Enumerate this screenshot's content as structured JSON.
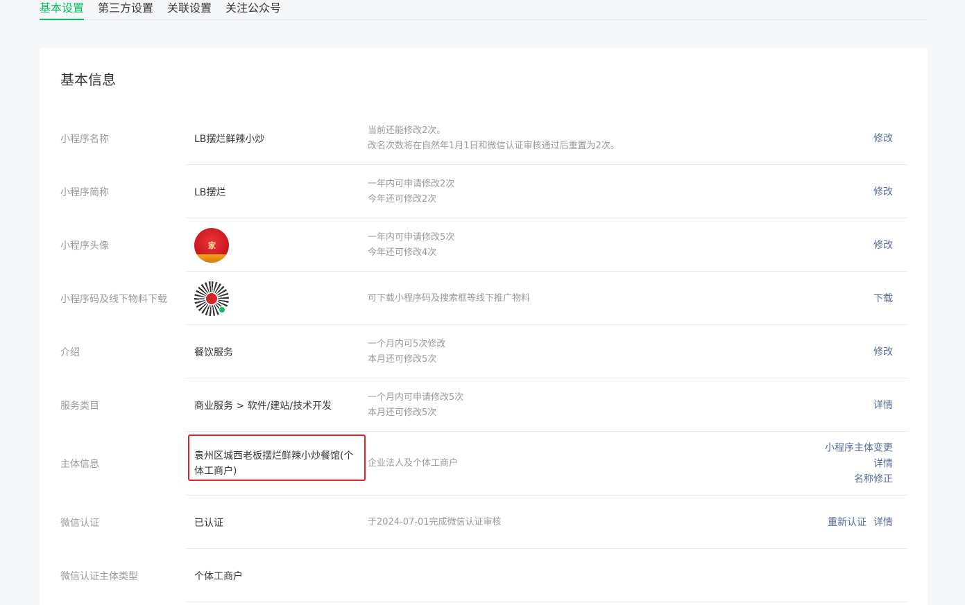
{
  "tabs": [
    "基本设置",
    "第三方设置",
    "关联设置",
    "关注公众号"
  ],
  "card_title": "基本信息",
  "rows": [
    {
      "label": "小程序名称",
      "value": "LB摆烂鲜辣小炒",
      "desc1": "当前还能修改2次。",
      "desc2": "改名次数将在自然年1月1日和微信认证审核通过后重置为2次。",
      "action": "修改"
    },
    {
      "label": "小程序简称",
      "value": "LB摆烂",
      "desc1": "一年内可申请修改2次",
      "desc2": "今年还可修改2次",
      "action": "修改"
    },
    {
      "label": "小程序头像",
      "desc1": "一年内可申请修改5次",
      "desc2": "今年还可修改4次",
      "action": "修改"
    },
    {
      "label": "小程序码及线下物料下载",
      "desc1": "可下载小程序码及搜索框等线下推广物料",
      "action": "下载"
    },
    {
      "label": "介绍",
      "value": "餐饮服务",
      "desc1": "一个月内可5次修改",
      "desc2": "本月还可修改5次",
      "action": "修改"
    },
    {
      "label": "服务类目",
      "value": "商业服务 > 软件/建站/技术开发",
      "desc1": "一个月内可申请修改5次",
      "desc2": "本月还可修改5次",
      "action": "详情"
    },
    {
      "label": "主体信息",
      "value": "袁州区城西老板摆烂鲜辣小炒餐馆(个体工商户)",
      "desc1": "企业法人及个体工商户",
      "actions": [
        "小程序主体变更",
        "详情",
        "名称修正"
      ]
    },
    {
      "label": "微信认证",
      "value": "已认证",
      "desc1": "于2024-07-01完成微信认证审核",
      "actions": [
        "重新认证",
        "详情"
      ]
    },
    {
      "label": "微信认证主体类型",
      "value": "个体工商户"
    }
  ],
  "avatar_text": "家",
  "colors": {
    "accent": "#07c160",
    "link": "#576b95",
    "highlight": "#e0202a"
  }
}
